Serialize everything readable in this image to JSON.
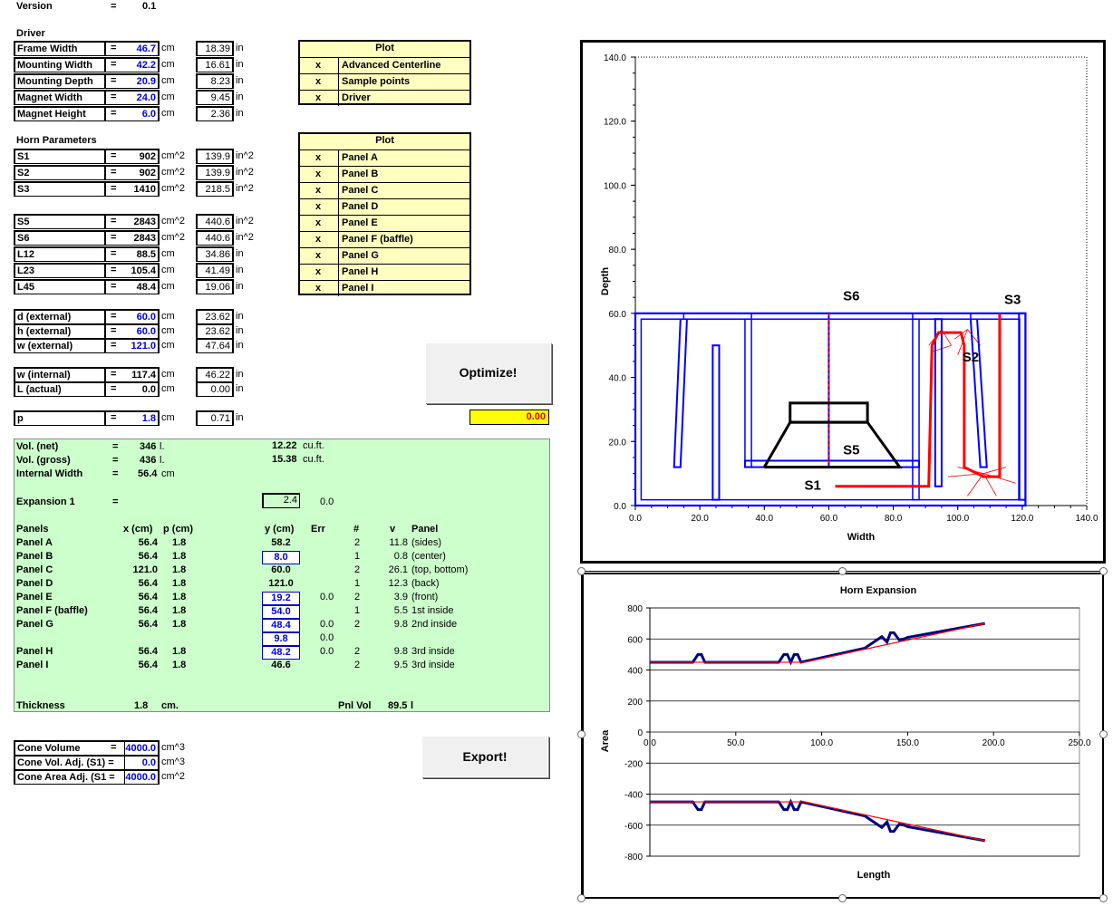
{
  "version": {
    "label": "Version",
    "eq": "=",
    "value": "0.1"
  },
  "driver": {
    "title": "Driver",
    "rows": [
      {
        "label": "Frame Width",
        "cm": "46.7",
        "in": "18.39"
      },
      {
        "label": "Mounting Width",
        "cm": "42.2",
        "in": "16.61"
      },
      {
        "label": "Mounting Depth",
        "cm": "20.9",
        "in": "8.23"
      },
      {
        "label": "Magnet Width",
        "cm": "24.0",
        "in": "9.45"
      },
      {
        "label": "Magnet Height",
        "cm": "6.0",
        "in": "2.36"
      }
    ]
  },
  "plot1": {
    "header": "Plot",
    "rows": [
      {
        "x": "x",
        "name": "Advanced Centerline"
      },
      {
        "x": "x",
        "name": "Sample points"
      },
      {
        "x": "x",
        "name": "Driver"
      }
    ]
  },
  "horn": {
    "title": "Horn Parameters",
    "rows": [
      {
        "label": "S1",
        "v": "902",
        "u": "cm^2",
        "iv": "139.9",
        "iu": "in^2"
      },
      {
        "label": "S2",
        "v": "902",
        "u": "cm^2",
        "iv": "139.9",
        "iu": "in^2"
      },
      {
        "label": "S3",
        "v": "1410",
        "u": "cm^2",
        "iv": "218.5",
        "iu": "in^2"
      },
      {
        "label": "S5",
        "v": "2843",
        "u": "cm^2",
        "iv": "440.6",
        "iu": "in^2"
      },
      {
        "label": "S6",
        "v": "2843",
        "u": "cm^2",
        "iv": "440.6",
        "iu": "in^2"
      },
      {
        "label": "L12",
        "v": "88.5",
        "u": "cm",
        "iv": "34.86",
        "iu": "in"
      },
      {
        "label": "L23",
        "v": "105.4",
        "u": "cm",
        "iv": "41.49",
        "iu": "in"
      },
      {
        "label": "L45",
        "v": "48.4",
        "u": "cm",
        "iv": "19.06",
        "iu": "in"
      }
    ]
  },
  "plot2": {
    "header": "Plot",
    "rows": [
      {
        "x": "x",
        "name": "Panel A"
      },
      {
        "x": "x",
        "name": "Panel B"
      },
      {
        "x": "x",
        "name": "Panel C"
      },
      {
        "x": "x",
        "name": "Panel D"
      },
      {
        "x": "x",
        "name": "Panel E"
      },
      {
        "x": "x",
        "name": "Panel F (baffle)"
      },
      {
        "x": "x",
        "name": "Panel G"
      },
      {
        "x": "x",
        "name": "Panel H"
      },
      {
        "x": "x",
        "name": "Panel I"
      }
    ]
  },
  "ext": {
    "rows": [
      {
        "label": "d (external)",
        "cm": "60.0",
        "in": "23.62"
      },
      {
        "label": "h (external)",
        "cm": "60.0",
        "in": "23.62"
      },
      {
        "label": "w (external)",
        "cm": "121.0",
        "in": "47.64"
      }
    ]
  },
  "internal": {
    "rows": [
      {
        "label": "w (internal)",
        "cm": "117.4",
        "in": "46.22",
        "blue": false
      },
      {
        "label": "L (actual)",
        "cm": "0.0",
        "in": "0.00",
        "blue": false
      }
    ]
  },
  "p": {
    "label": "p",
    "cm": "1.8",
    "in": "0.71"
  },
  "units": {
    "cm": "cm",
    "in": "in",
    "eq": "="
  },
  "buttons": {
    "optimize": "Optimize!",
    "export": "Export!"
  },
  "yellow_value": "0.00",
  "green": {
    "vol_net": {
      "label": "Vol. (net)",
      "v": "346",
      "u": "l.",
      "cf": "12.22",
      "cfu": "cu.ft."
    },
    "vol_gross": {
      "label": "Vol. (gross)",
      "v": "436",
      "u": "l.",
      "cf": "15.38",
      "cfu": "cu.ft."
    },
    "internal_width": {
      "label": "Internal Width",
      "v": "56.4",
      "u": "cm"
    },
    "expansion": {
      "label": "Expansion 1",
      "eq": "=",
      "v": "2.4",
      "v2": "0.0"
    },
    "headers": {
      "panels": "Panels",
      "x": "x (cm)",
      "p": "p (cm)",
      "y": "y (cm)",
      "err": "Err",
      "n": "#",
      "v": "v",
      "panel": "Panel"
    },
    "rows": [
      {
        "name": "Panel A",
        "x": "56.4",
        "p": "1.8",
        "y": "58.2",
        "ybox": false,
        "err": "",
        "n": "2",
        "v": "11.8",
        "desc": "(sides)"
      },
      {
        "name": "Panel B",
        "x": "56.4",
        "p": "1.8",
        "y": "8.0",
        "ybox": true,
        "err": "",
        "n": "1",
        "v": "0.8",
        "desc": "(center)"
      },
      {
        "name": "Panel C",
        "x": "121.0",
        "p": "1.8",
        "y": "60.0",
        "ybox": false,
        "err": "",
        "n": "2",
        "v": "26.1",
        "desc": "(top, bottom)"
      },
      {
        "name": "Panel D",
        "x": "56.4",
        "p": "1.8",
        "y": "121.0",
        "ybox": false,
        "err": "",
        "n": "1",
        "v": "12.3",
        "desc": "(back)"
      },
      {
        "name": "Panel E",
        "x": "56.4",
        "p": "1.8",
        "y": "19.2",
        "ybox": true,
        "err": "0.0",
        "n": "2",
        "v": "3.9",
        "desc": "(front)"
      },
      {
        "name": "Panel F (baffle)",
        "x": "56.4",
        "p": "1.8",
        "y": "54.0",
        "ybox": true,
        "err": "",
        "n": "1",
        "v": "5.5",
        "desc": "1st inside"
      },
      {
        "name": "Panel G",
        "x": "56.4",
        "p": "1.8",
        "y": "48.4",
        "ybox": true,
        "err": "0.0",
        "n": "2",
        "v": "9.8",
        "desc": "2nd inside"
      },
      {
        "name": "",
        "x": "",
        "p": "",
        "y": "9.8",
        "ybox": true,
        "err": "0.0",
        "n": "",
        "v": "",
        "desc": ""
      },
      {
        "name": "Panel H",
        "x": "56.4",
        "p": "1.8",
        "y": "48.2",
        "ybox": true,
        "err": "0.0",
        "n": "2",
        "v": "9.8",
        "desc": "3rd inside"
      },
      {
        "name": "Panel I",
        "x": "56.4",
        "p": "1.8",
        "y": "46.6",
        "ybox": false,
        "err": "",
        "n": "2",
        "v": "9.5",
        "desc": "3rd inside"
      }
    ],
    "thickness": {
      "label": "Thickness",
      "v": "1.8",
      "u": "cm.",
      "pnl": "Pnl Vol",
      "pv": "89.5",
      "pu": "l"
    }
  },
  "cone": {
    "rows": [
      {
        "label": "Cone Volume",
        "eq": "=",
        "v": "4000.0",
        "u": "cm^3"
      },
      {
        "label": "Cone Vol. Adj. (S1) =",
        "eq": "",
        "v": "0.0",
        "u": "cm^3"
      },
      {
        "label": "Cone Area Adj. (S1 =",
        "eq": "",
        "v": "4000.0",
        "u": "cm^2"
      }
    ]
  },
  "chart_data": [
    {
      "type": "scatter",
      "title": "",
      "xlabel": "Width",
      "ylabel": "Depth",
      "xlim": [
        0,
        140
      ],
      "ylim": [
        0,
        140
      ],
      "xticks": [
        "0.0",
        "20.0",
        "40.0",
        "60.0",
        "80.0",
        "100.0",
        "120.0",
        "140.0"
      ],
      "yticks": [
        "0.0",
        "20.0",
        "40.0",
        "60.0",
        "80.0",
        "100.0",
        "120.0",
        "140.0"
      ],
      "annotations": [
        {
          "text": "S6",
          "x": 67,
          "y": 64
        },
        {
          "text": "S3",
          "x": 117,
          "y": 63
        },
        {
          "text": "S2",
          "x": 104,
          "y": 45
        },
        {
          "text": "S5",
          "x": 67,
          "y": 16
        },
        {
          "text": "S1",
          "x": 55,
          "y": 5
        }
      ],
      "colors": {
        "panels": "#0000ff",
        "centerline": "#ff0000",
        "driver": "#000000"
      }
    },
    {
      "type": "line",
      "title": "Horn Expansion",
      "xlabel": "Length",
      "ylabel": "Area",
      "xlim": [
        0,
        250
      ],
      "ylim": [
        -800,
        800
      ],
      "xticks": [
        "0.0",
        "50.0",
        "100.0",
        "150.0",
        "200.0",
        "250.0"
      ],
      "yticks": [
        "800",
        "600",
        "400",
        "200",
        "0",
        "-200",
        "-400",
        "-600",
        "-800"
      ],
      "series": [
        {
          "color": "#000080",
          "x": [
            0,
            25,
            28,
            30,
            32,
            60,
            75,
            78,
            80,
            82,
            84,
            86,
            88,
            90,
            125,
            133,
            135,
            138,
            140,
            142,
            145,
            148,
            150,
            195
          ],
          "y": [
            450,
            450,
            500,
            500,
            450,
            450,
            450,
            500,
            500,
            450,
            500,
            500,
            450,
            455,
            540,
            600,
            615,
            580,
            640,
            640,
            595,
            600,
            610,
            700
          ]
        },
        {
          "color": "#ff0000",
          "x": [
            0,
            90,
            195
          ],
          "y": [
            450,
            450,
            700
          ]
        }
      ]
    }
  ]
}
